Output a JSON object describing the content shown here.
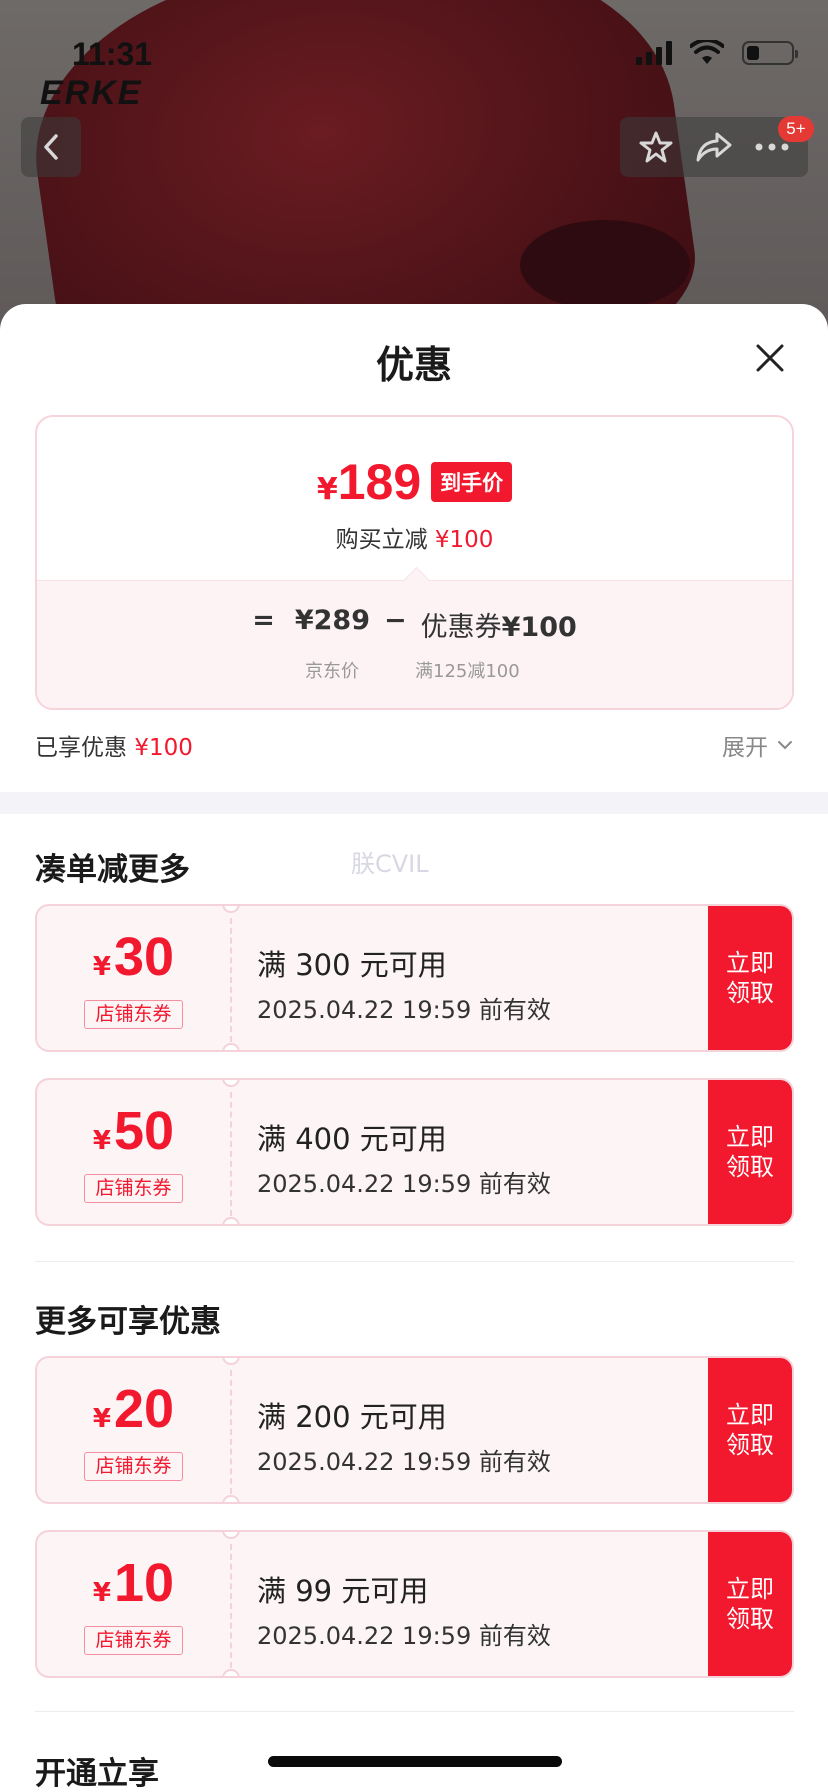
{
  "status_bar": {
    "time": "11:31"
  },
  "brand": {
    "logo_text": "ERKE"
  },
  "nav": {
    "cart_badge": "5+"
  },
  "sheet": {
    "title": "优惠",
    "summary": {
      "currency": "¥",
      "final_price": "189",
      "final_tag": "到手价",
      "instant_off_label": "购买立减",
      "instant_off_value": "¥100",
      "formula": {
        "eq": "=",
        "jd_price": "¥289",
        "minus": "−",
        "coupon_label": "优惠券",
        "coupon_value": "¥100",
        "jd_price_caption": "京东价",
        "coupon_caption": "满125减100"
      }
    },
    "enjoyed": {
      "label": "已享优惠",
      "value": "¥100"
    },
    "expand_label": "展开",
    "watermark": "朕CVIL",
    "sections": [
      {
        "title": "凑单减更多",
        "coupons": [
          {
            "currency": "¥",
            "amount": "30",
            "type": "店铺东券",
            "condition": "满 300 元可用",
            "valid": "2025.04.22 19:59 前有效",
            "claim": "立即\n领取"
          },
          {
            "currency": "¥",
            "amount": "50",
            "type": "店铺东券",
            "condition": "满 400 元可用",
            "valid": "2025.04.22 19:59 前有效",
            "claim": "立即\n领取"
          }
        ]
      },
      {
        "title": "更多可享优惠",
        "coupons": [
          {
            "currency": "¥",
            "amount": "20",
            "type": "店铺东券",
            "condition": "满 200 元可用",
            "valid": "2025.04.22 19:59 前有效",
            "claim": "立即\n领取"
          },
          {
            "currency": "¥",
            "amount": "10",
            "type": "店铺东券",
            "condition": "满 99 元可用",
            "valid": "2025.04.22 19:59 前有效",
            "claim": "立即\n领取"
          }
        ]
      },
      {
        "title": "开通立享"
      }
    ]
  }
}
